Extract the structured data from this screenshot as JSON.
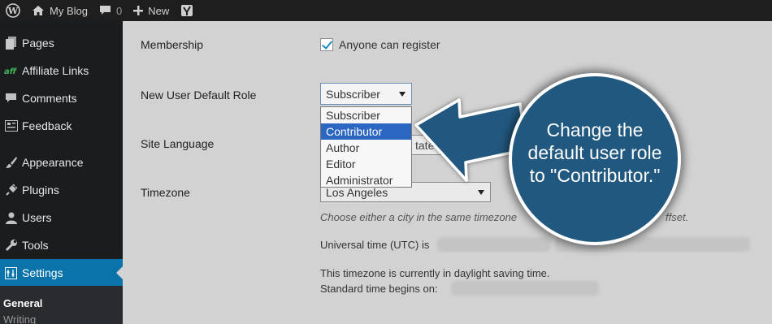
{
  "admin_bar": {
    "site_name": "My Blog",
    "comments_count": "0",
    "new_label": "New"
  },
  "sidebar": {
    "items": [
      {
        "label": "Pages",
        "icon": "pages-icon"
      },
      {
        "label": "Affiliate Links",
        "icon": "affiliate-icon"
      },
      {
        "label": "Comments",
        "icon": "comment-icon"
      },
      {
        "label": "Feedback",
        "icon": "feedback-icon"
      },
      {
        "label": "Appearance",
        "icon": "brush-icon"
      },
      {
        "label": "Plugins",
        "icon": "plugin-icon"
      },
      {
        "label": "Users",
        "icon": "user-icon"
      },
      {
        "label": "Tools",
        "icon": "wrench-icon"
      },
      {
        "label": "Settings",
        "icon": "settings-icon"
      }
    ],
    "submenu": {
      "current": "General"
    },
    "accent_color": "#0a73aa"
  },
  "settings": {
    "membership": {
      "label": "Membership",
      "checkbox_label": "Anyone can register",
      "checked": true
    },
    "default_role": {
      "label": "New User Default Role",
      "selected": "Subscriber",
      "options": [
        "Subscriber",
        "Contributor",
        "Author",
        "Editor",
        "Administrator"
      ],
      "highlighted": "Contributor"
    },
    "site_language": {
      "label": "Site Language",
      "visible_fragment": "tate"
    },
    "timezone": {
      "label": "Timezone",
      "selected": "Los Angeles",
      "hint": "Choose either a city in the same timezone",
      "hint_tail": "ffset.",
      "utc_label": "Universal time (UTC) is",
      "dst_note": "This timezone is currently in daylight saving time.",
      "standard_time_label": "Standard time begins on:"
    }
  },
  "callout": {
    "text": "Change the default user role to \"Contributor.\"",
    "color": "#20587f"
  }
}
